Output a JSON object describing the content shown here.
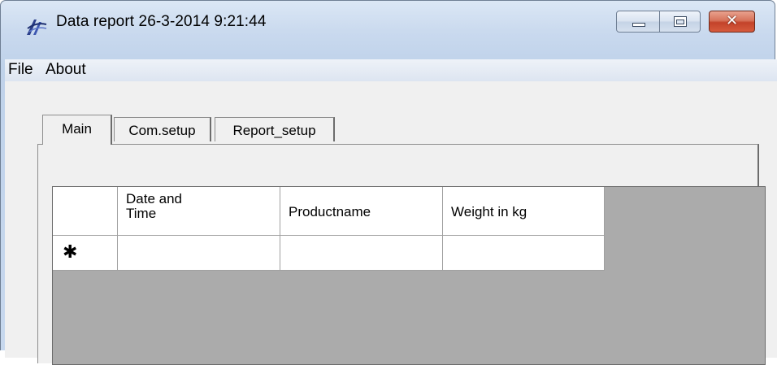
{
  "window": {
    "title": "Data report 26-3-2014 9:21:44",
    "app_icon": "app-logo-icon",
    "controls": {
      "minimize_icon": "minimize-icon",
      "maximize_icon": "maximize-icon",
      "close_glyph": "✕",
      "close_icon": "close-icon"
    }
  },
  "menubar": {
    "items": [
      {
        "label": "File"
      },
      {
        "label": "About"
      }
    ]
  },
  "tabs": [
    {
      "label": "Main",
      "selected": true
    },
    {
      "label": "Com.setup",
      "selected": false
    },
    {
      "label": "Report_setup",
      "selected": false
    }
  ],
  "grid": {
    "columns": [
      {
        "label": "Date and Time"
      },
      {
        "label": "Productname"
      },
      {
        "label": "Weight in kg"
      }
    ],
    "new_row_marker": "✱",
    "rows": []
  },
  "colors": {
    "grid_background": "#ababab",
    "close_button": "#c3432a",
    "titlebar": "#c9d9ee"
  }
}
